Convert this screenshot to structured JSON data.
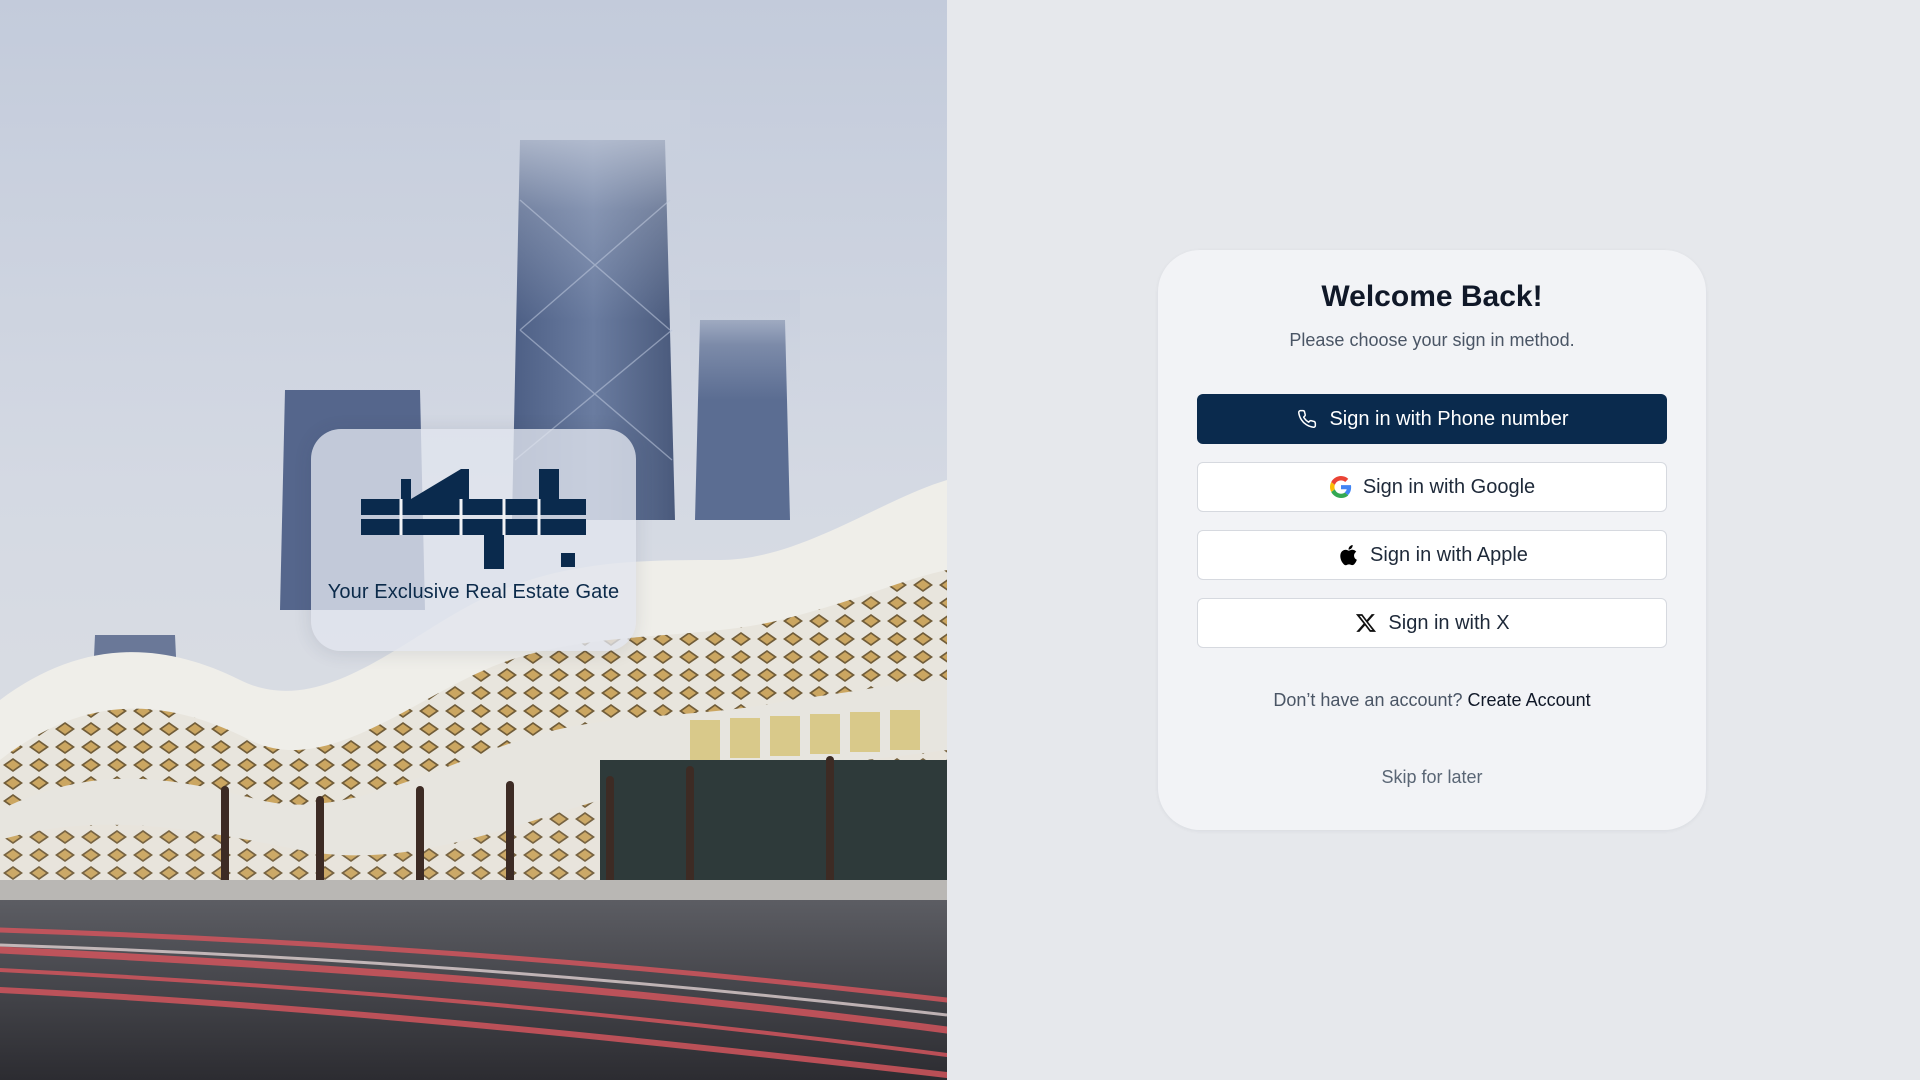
{
  "hero": {
    "tagline": "Your Exclusive Real Estate Gate",
    "logo_icon": "bawabat-logo-mark",
    "brand_color": "#0a2a4d"
  },
  "signin": {
    "title": "Welcome Back!",
    "subtitle": "Please choose your sign in method.",
    "buttons": {
      "phone": {
        "label": "Sign in with Phone number",
        "icon": "phone-icon"
      },
      "google": {
        "label": "Sign in with Google",
        "icon": "google-icon"
      },
      "apple": {
        "label": "Sign in with Apple",
        "icon": "apple-icon"
      },
      "x": {
        "label": "Sign in with X",
        "icon": "x-icon"
      }
    },
    "signup_prompt": "Don’t have an account?",
    "signup_link": "Create Account",
    "skip": "Skip for later"
  },
  "colors": {
    "primary": "#0a2a4d",
    "background": "#e6e8ec",
    "card": "#f2f3f6"
  }
}
